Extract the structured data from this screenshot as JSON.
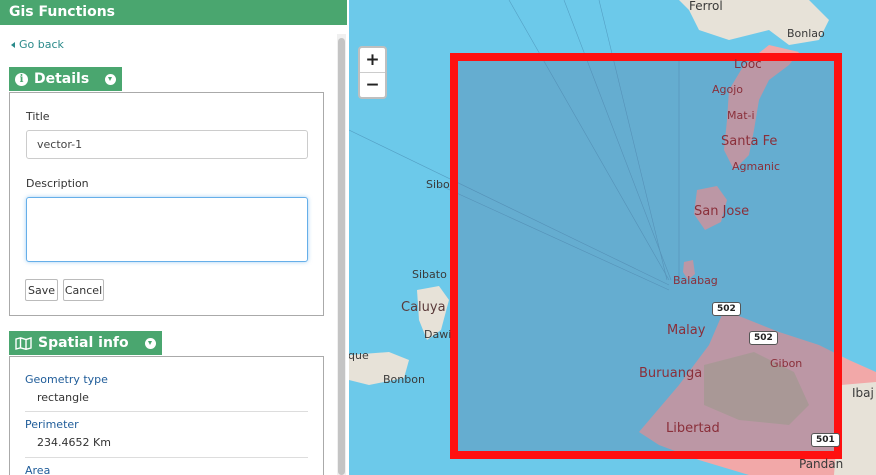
{
  "app": {
    "title": "Gis Functions"
  },
  "nav": {
    "go_back": "Go back"
  },
  "details": {
    "header": "Details",
    "title_label": "Title",
    "title_value": "vector-1",
    "description_label": "Description",
    "description_value": "",
    "save_label": "Save",
    "cancel_label": "Cancel"
  },
  "spatial": {
    "header": "Spatial info",
    "geometry_type_label": "Geometry type",
    "geometry_type_value": "rectangle",
    "perimeter_label": "Perimeter",
    "perimeter_value": "234.4652 Km",
    "area_label": "Area"
  },
  "map": {
    "zoom_in": "+",
    "zoom_out": "−",
    "selection_color": "#ff1010",
    "water_color": "#6cc9ea",
    "land_color": "#f2a8a8",
    "places": {
      "ferrol": "Ferrol",
      "bonlao": "Bonlao",
      "looc": "Looc",
      "agojo": "Agojo",
      "mati": "Mat-i",
      "santa_fe": "Santa Fe",
      "agmanic": "Agmanic",
      "sibo": "Sibo",
      "san_jose": "San Jose",
      "sibato": "Sibato",
      "caluya": "Caluya",
      "dawi": "Dawi",
      "balabag": "Balabag",
      "malay": "Malay",
      "gibon": "Gibon",
      "buruanga": "Buruanga",
      "bonbon": "Bonbon",
      "libertad": "Libertad",
      "pandan": "Pandan",
      "ibaj": "Ibaj",
      "que": "que"
    },
    "shields": {
      "r502a": "502",
      "r502b": "502",
      "r501": "501"
    }
  }
}
